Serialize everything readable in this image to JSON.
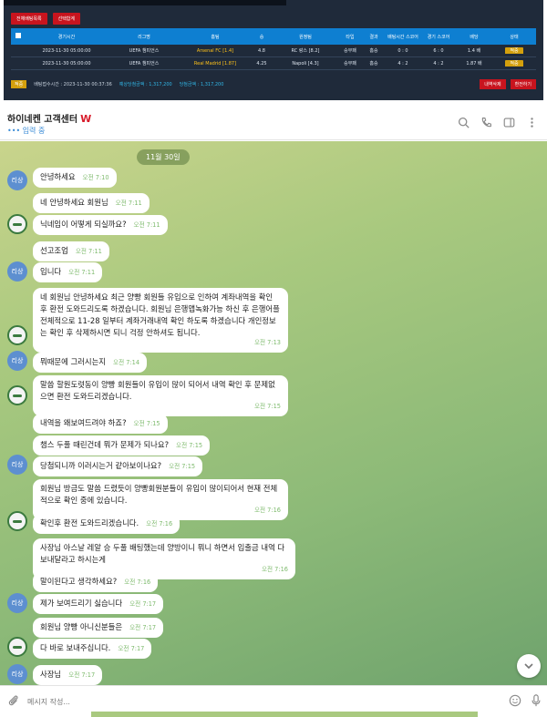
{
  "bet_screen": {
    "buttons": [
      "전체배팅목록",
      "선택합계"
    ],
    "columns": [
      "",
      "경기시간",
      "리그명",
      "홈팀",
      "승",
      "원정팀",
      "타입",
      "결과",
      "배팅시간 스코어",
      "경기 스코어",
      "배당",
      "상태"
    ],
    "rows": [
      [
        "",
        "2023-11-30 05:00:00",
        "UEFA 챔피언스",
        "Arsenal FC [1.4]",
        "4.8",
        "RC 랑스 [8.2]",
        "승무패",
        "홈승",
        "0 : 0",
        "6 : 0",
        "1.4 배",
        "적중"
      ],
      [
        "",
        "2023-11-30 05:00:00",
        "UEFA 챔피언스",
        "Real Madrid [1.87]",
        "4.25",
        "Napoli [4.3]",
        "승무패",
        "홈승",
        "4 : 2",
        "4 : 2",
        "1.87 배",
        "적중"
      ]
    ],
    "footer_badge": "적중",
    "footer_text": "배팅접수시간 : 2023-11-30 00:37:36",
    "footer_amount": "예상당첨금액 : 1,317,200",
    "footer_amount2": "당첨금액 : 1,317,200",
    "footer_buttons": [
      "내역삭제",
      "환전하기"
    ]
  },
  "chat_header": {
    "title": "하이네켄 고객센터",
    "logo_letter": "W",
    "status": "••• 입력 중",
    "icons": [
      "search-icon",
      "phone-icon",
      "sidebar-icon",
      "more-icon"
    ]
  },
  "chat": {
    "date_badge": "11월 30일",
    "messages": [
      {
        "sender": "user",
        "avatar": "리상",
        "text": "안녕하세요",
        "time": "오전 7:10"
      },
      {
        "sender": "agent",
        "text": "네 안녕하세요 회원님",
        "time": "오전 7:11"
      },
      {
        "sender": "agent",
        "text": "닉네임이 어떻게 되실까요?",
        "time": "오전 7:11"
      },
      {
        "sender": "user",
        "text": "선고조업",
        "time": "오전 7:11"
      },
      {
        "sender": "user",
        "avatar": "리상",
        "text": "입니다",
        "time": "오전 7:11"
      },
      {
        "sender": "agent",
        "text": "네 회원님 안녕하세요 최근 양빵 회원들 유입으로 인하여 계좌내역을 확인 후 환전 도와드리도록 하겠습니다. 회원님 은행앱녹화가능 하신 후 은행어플 전체적으로 11-28 일부터 계좌거래내역 확인 하도록 하겠습니다 개인정보는 확인 후 삭제하시면 되니 걱정 안하셔도 됩니다.",
        "time": "오전 7:13"
      },
      {
        "sender": "user",
        "avatar": "리상",
        "text": "뭐때문에 그러시는지",
        "time": "오전 7:14"
      },
      {
        "sender": "agent",
        "text": "말씀 할원도렷동이 양빵 회원들이 유입이 많이 되어서 내역 확인 후 문제없으면 환전 도와드리겠습니다.",
        "time": "오전 7:15"
      },
      {
        "sender": "user",
        "text": "내역을 왜보여드려야 하죠?",
        "time": "오전 7:15"
      },
      {
        "sender": "user",
        "text": "챔스 두풀 때린건데 뭐가 문제가 되나요?",
        "time": "오전 7:15"
      },
      {
        "sender": "user",
        "avatar": "리상",
        "text": "당첨되니까 이러시는거 같아보이나요?",
        "time": "오전 7:15"
      },
      {
        "sender": "agent",
        "text": "회원님 방금도 말씀 드렸듯이 양빵회원분들이 유입이 많이되어서 현재 전체적으로 확인 중에 있습니다.",
        "time": "오전 7:16"
      },
      {
        "sender": "agent",
        "text": "확인후 환전 도와드리겠습니다.",
        "time": "오전 7:16"
      },
      {
        "sender": "user",
        "text": "사장님 아스날 레알 승 두풀 배팅했는데 양방이니 뭐니 하면서 입출금 내역 다보내달라고 하시는게",
        "time": "오전 7:16"
      },
      {
        "sender": "user",
        "text": "말이된다고 생각하세요?",
        "time": "오전 7:16"
      },
      {
        "sender": "user",
        "avatar": "리상",
        "text": "제가 보여드리기 싫습니다",
        "time": "오전 7:17"
      },
      {
        "sender": "agent",
        "text": "회원님 양빵 아니신분들은",
        "time": "오전 7:17"
      },
      {
        "sender": "agent",
        "text": "다 바로 보내주십니다.",
        "time": "오전 7:17"
      },
      {
        "sender": "user",
        "avatar": "리상",
        "text": "사장님",
        "time": "오전 7:17"
      }
    ]
  },
  "input": {
    "placeholder": "메시지 작성..."
  },
  "colors": {
    "bet_bg": "#1f2a3a",
    "bet_header": "#0e7fd1",
    "red_button": "#c8141e",
    "gold": "#d4a00d",
    "chat_bg_top": "#c9d48c",
    "chat_bg_bottom": "#6fa36d",
    "tick_green": "#7fbb6e"
  }
}
